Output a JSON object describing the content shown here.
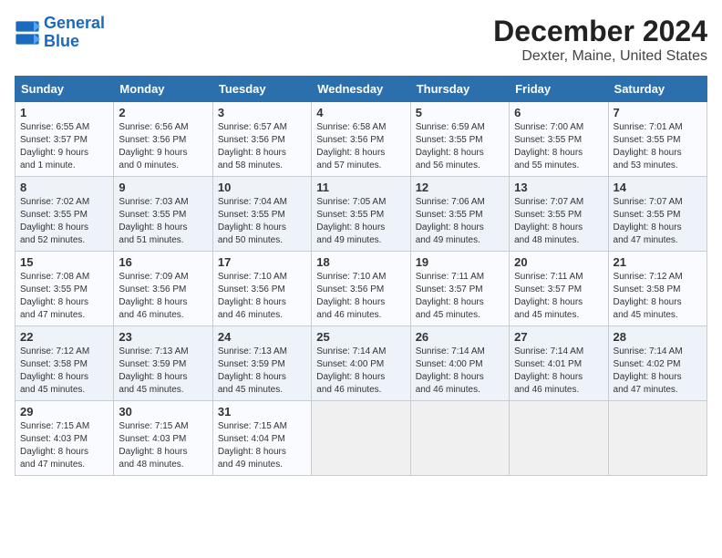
{
  "header": {
    "logo_line1": "General",
    "logo_line2": "Blue",
    "title": "December 2024",
    "subtitle": "Dexter, Maine, United States"
  },
  "days_of_week": [
    "Sunday",
    "Monday",
    "Tuesday",
    "Wednesday",
    "Thursday",
    "Friday",
    "Saturday"
  ],
  "weeks": [
    [
      {
        "day": "1",
        "info": "Sunrise: 6:55 AM\nSunset: 3:57 PM\nDaylight: 9 hours\nand 1 minute."
      },
      {
        "day": "2",
        "info": "Sunrise: 6:56 AM\nSunset: 3:56 PM\nDaylight: 9 hours\nand 0 minutes."
      },
      {
        "day": "3",
        "info": "Sunrise: 6:57 AM\nSunset: 3:56 PM\nDaylight: 8 hours\nand 58 minutes."
      },
      {
        "day": "4",
        "info": "Sunrise: 6:58 AM\nSunset: 3:56 PM\nDaylight: 8 hours\nand 57 minutes."
      },
      {
        "day": "5",
        "info": "Sunrise: 6:59 AM\nSunset: 3:55 PM\nDaylight: 8 hours\nand 56 minutes."
      },
      {
        "day": "6",
        "info": "Sunrise: 7:00 AM\nSunset: 3:55 PM\nDaylight: 8 hours\nand 55 minutes."
      },
      {
        "day": "7",
        "info": "Sunrise: 7:01 AM\nSunset: 3:55 PM\nDaylight: 8 hours\nand 53 minutes."
      }
    ],
    [
      {
        "day": "8",
        "info": "Sunrise: 7:02 AM\nSunset: 3:55 PM\nDaylight: 8 hours\nand 52 minutes."
      },
      {
        "day": "9",
        "info": "Sunrise: 7:03 AM\nSunset: 3:55 PM\nDaylight: 8 hours\nand 51 minutes."
      },
      {
        "day": "10",
        "info": "Sunrise: 7:04 AM\nSunset: 3:55 PM\nDaylight: 8 hours\nand 50 minutes."
      },
      {
        "day": "11",
        "info": "Sunrise: 7:05 AM\nSunset: 3:55 PM\nDaylight: 8 hours\nand 49 minutes."
      },
      {
        "day": "12",
        "info": "Sunrise: 7:06 AM\nSunset: 3:55 PM\nDaylight: 8 hours\nand 49 minutes."
      },
      {
        "day": "13",
        "info": "Sunrise: 7:07 AM\nSunset: 3:55 PM\nDaylight: 8 hours\nand 48 minutes."
      },
      {
        "day": "14",
        "info": "Sunrise: 7:07 AM\nSunset: 3:55 PM\nDaylight: 8 hours\nand 47 minutes."
      }
    ],
    [
      {
        "day": "15",
        "info": "Sunrise: 7:08 AM\nSunset: 3:55 PM\nDaylight: 8 hours\nand 47 minutes."
      },
      {
        "day": "16",
        "info": "Sunrise: 7:09 AM\nSunset: 3:56 PM\nDaylight: 8 hours\nand 46 minutes."
      },
      {
        "day": "17",
        "info": "Sunrise: 7:10 AM\nSunset: 3:56 PM\nDaylight: 8 hours\nand 46 minutes."
      },
      {
        "day": "18",
        "info": "Sunrise: 7:10 AM\nSunset: 3:56 PM\nDaylight: 8 hours\nand 46 minutes."
      },
      {
        "day": "19",
        "info": "Sunrise: 7:11 AM\nSunset: 3:57 PM\nDaylight: 8 hours\nand 45 minutes."
      },
      {
        "day": "20",
        "info": "Sunrise: 7:11 AM\nSunset: 3:57 PM\nDaylight: 8 hours\nand 45 minutes."
      },
      {
        "day": "21",
        "info": "Sunrise: 7:12 AM\nSunset: 3:58 PM\nDaylight: 8 hours\nand 45 minutes."
      }
    ],
    [
      {
        "day": "22",
        "info": "Sunrise: 7:12 AM\nSunset: 3:58 PM\nDaylight: 8 hours\nand 45 minutes."
      },
      {
        "day": "23",
        "info": "Sunrise: 7:13 AM\nSunset: 3:59 PM\nDaylight: 8 hours\nand 45 minutes."
      },
      {
        "day": "24",
        "info": "Sunrise: 7:13 AM\nSunset: 3:59 PM\nDaylight: 8 hours\nand 45 minutes."
      },
      {
        "day": "25",
        "info": "Sunrise: 7:14 AM\nSunset: 4:00 PM\nDaylight: 8 hours\nand 46 minutes."
      },
      {
        "day": "26",
        "info": "Sunrise: 7:14 AM\nSunset: 4:00 PM\nDaylight: 8 hours\nand 46 minutes."
      },
      {
        "day": "27",
        "info": "Sunrise: 7:14 AM\nSunset: 4:01 PM\nDaylight: 8 hours\nand 46 minutes."
      },
      {
        "day": "28",
        "info": "Sunrise: 7:14 AM\nSunset: 4:02 PM\nDaylight: 8 hours\nand 47 minutes."
      }
    ],
    [
      {
        "day": "29",
        "info": "Sunrise: 7:15 AM\nSunset: 4:03 PM\nDaylight: 8 hours\nand 47 minutes."
      },
      {
        "day": "30",
        "info": "Sunrise: 7:15 AM\nSunset: 4:03 PM\nDaylight: 8 hours\nand 48 minutes."
      },
      {
        "day": "31",
        "info": "Sunrise: 7:15 AM\nSunset: 4:04 PM\nDaylight: 8 hours\nand 49 minutes."
      },
      {
        "day": "",
        "info": ""
      },
      {
        "day": "",
        "info": ""
      },
      {
        "day": "",
        "info": ""
      },
      {
        "day": "",
        "info": ""
      }
    ]
  ]
}
